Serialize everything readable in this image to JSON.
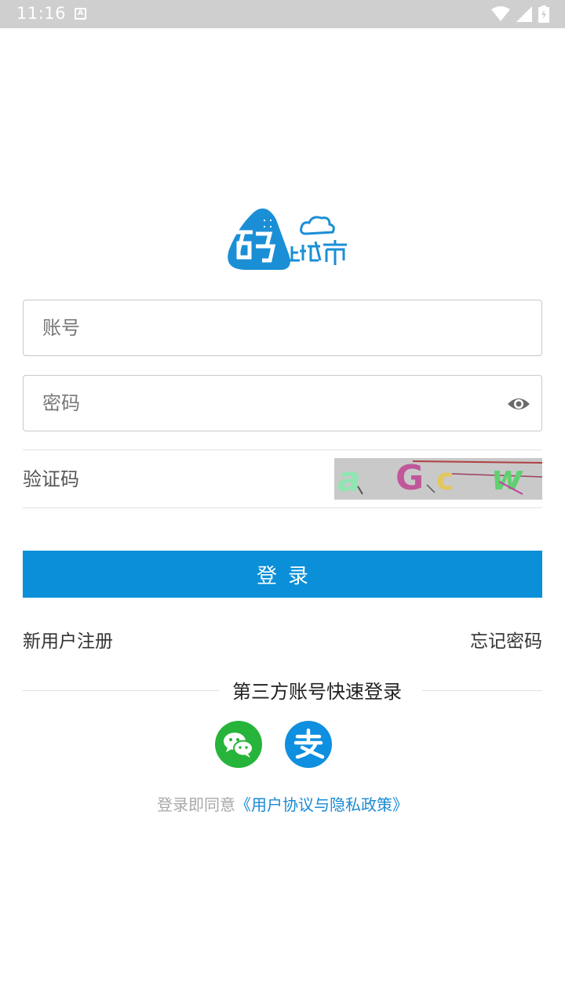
{
  "status_bar": {
    "time": "11:16",
    "icons": [
      "a-notification-icon",
      "wifi-icon",
      "signal-icon",
      "battery-icon"
    ]
  },
  "logo": {
    "alt": "码上城市"
  },
  "form": {
    "account_placeholder": "账号",
    "password_placeholder": "密码",
    "captcha_placeholder": "验证码",
    "captcha_text": "aGcw"
  },
  "login_button_label": "登录",
  "links": {
    "register": "新用户注册",
    "forgot_password": "忘记密码"
  },
  "third_party": {
    "title": "第三方账号快速登录",
    "providers": [
      "wechat",
      "alipay"
    ]
  },
  "agreement": {
    "prefix": "登录即同意",
    "link": "《用户协议与隐私政策》"
  },
  "colors": {
    "primary": "#0b8fd8",
    "wechat": "#27b43a",
    "alipay": "#0e8fe0",
    "status_bar": "#cfcfcf"
  }
}
